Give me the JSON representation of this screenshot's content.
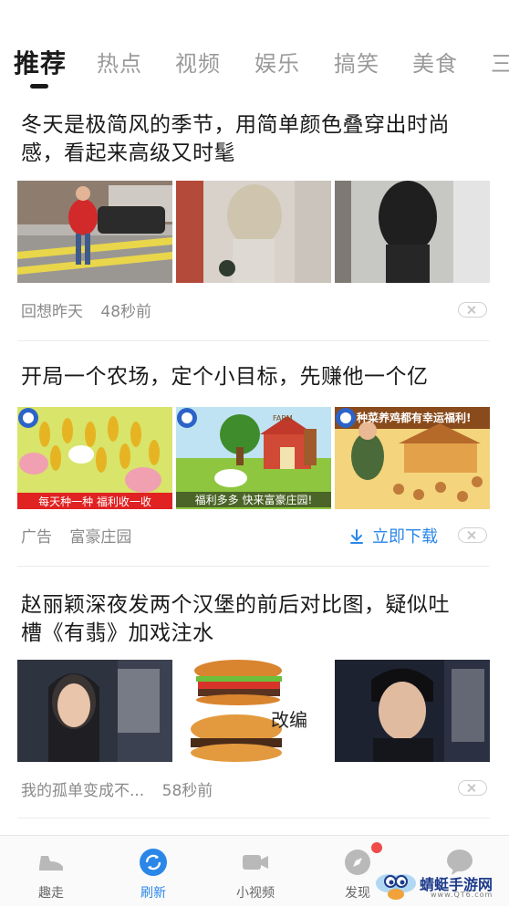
{
  "tabs": [
    "推荐",
    "热点",
    "视频",
    "娱乐",
    "搞笑",
    "美食",
    "三"
  ],
  "articles": [
    {
      "title_line1": "冬天是极简风的季节，用简单颜色叠穿出时尚",
      "title_line2": "感，看起来高级又时髦",
      "source": "回想昨天",
      "time": "48秒前"
    },
    {
      "title_line1": "开局一个农场，定个小目标，先赚他一个亿",
      "ad_label": "广告",
      "source": "富豪庄园",
      "download_label": "立即下载",
      "banner1": "每天种一种  福利收一收",
      "banner2": "福利多多  快来富豪庄园!",
      "banner3": "种菜养鸡都有幸运福利!",
      "barn_sign": "FARM"
    },
    {
      "title_line1": "赵丽颖深夜发两个汉堡的前后对比图，疑似吐",
      "title_line2": "槽《有翡》加戏注水",
      "source": "我的孤单变成不...",
      "time": "58秒前",
      "overlay": "改编"
    }
  ],
  "bottom_nav": [
    {
      "label": "趣走",
      "icon": "shoe-icon"
    },
    {
      "label": "刷新",
      "icon": "refresh-icon",
      "active": true
    },
    {
      "label": "小视频",
      "icon": "video-camera-icon"
    },
    {
      "label": "发现",
      "icon": "compass-icon"
    },
    {
      "label": "",
      "icon": "chat-bubble-icon"
    }
  ],
  "watermark": {
    "name": "蜻蜓手游网",
    "url": "www.QT6.com"
  },
  "colors": {
    "accent": "#2a87e8",
    "badge": "#f04a4a",
    "text": "#1a1a1a",
    "muted": "#8a8a8a"
  }
}
